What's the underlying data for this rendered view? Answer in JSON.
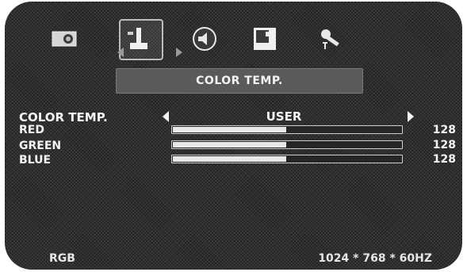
{
  "menu_tabs": [
    {
      "icon": "picture-icon",
      "selected": false
    },
    {
      "icon": "color-adjust-icon",
      "selected": true
    },
    {
      "icon": "audio-icon",
      "selected": false
    },
    {
      "icon": "window-position-icon",
      "selected": false
    },
    {
      "icon": "setup-tools-icon",
      "selected": false
    }
  ],
  "header": {
    "title": "COLOR TEMP."
  },
  "color_temp": {
    "label": "COLOR TEMP.",
    "value": "USER"
  },
  "channels": [
    {
      "label": "RED",
      "value": "128",
      "level": 0.5
    },
    {
      "label": "GREEN",
      "value": "128",
      "level": 0.5
    },
    {
      "label": "BLUE",
      "value": "128",
      "level": 0.5
    }
  ],
  "status": {
    "signal": "RGB",
    "resolution": "1024 * 768 * 60HZ"
  },
  "colors": {
    "panel": "#2f2f2f",
    "text": "#f4f4f4",
    "header_bg": "#5a5a5a",
    "bar_fill": "#e8e8e8"
  }
}
